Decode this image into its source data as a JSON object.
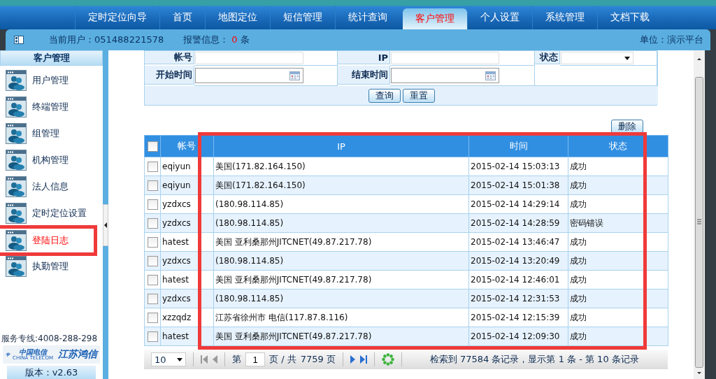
{
  "nav": {
    "tabs": [
      {
        "label": "定时定位向导",
        "selected": false
      },
      {
        "label": "首页",
        "selected": false
      },
      {
        "label": "地图定位",
        "selected": false
      },
      {
        "label": "短信管理",
        "selected": false
      },
      {
        "label": "统计查询",
        "selected": false
      },
      {
        "label": "客户管理",
        "selected": true
      },
      {
        "label": "个人设置",
        "selected": false
      },
      {
        "label": "系统管理",
        "selected": false
      },
      {
        "label": "文档下载",
        "selected": false
      }
    ]
  },
  "info_bar": {
    "user": "当前用户：051488221578",
    "alarm_label": "报警信息：",
    "alarm_count": "0",
    "alarm_unit": "条",
    "unit": "单位：演示平台"
  },
  "sidebar": {
    "title": "客户管理",
    "items": [
      {
        "label": "用户管理",
        "selected": false,
        "highlighted": false
      },
      {
        "label": "终端管理",
        "selected": false,
        "highlighted": false
      },
      {
        "label": "组管理",
        "selected": false,
        "highlighted": false
      },
      {
        "label": "机构管理",
        "selected": false,
        "highlighted": false
      },
      {
        "label": "法人信息",
        "selected": false,
        "highlighted": false
      },
      {
        "label": "定时定位设置",
        "selected": false,
        "highlighted": false
      },
      {
        "label": "登陆日志",
        "selected": true,
        "highlighted": true
      },
      {
        "label": "执勤管理",
        "selected": false,
        "highlighted": false
      }
    ],
    "hotline": "服务专线:4008-288-298",
    "logo": {
      "brand": "中国电信",
      "brand_en": "CHINA TELECOM",
      "company": "江苏鸿信"
    },
    "version": "版本：v2.63"
  },
  "filter": {
    "fields": [
      {
        "label": "帐号",
        "kind": "text"
      },
      {
        "label": "IP",
        "kind": "text"
      },
      {
        "label": "状态",
        "kind": "select"
      },
      {
        "label": "开始时间",
        "kind": "date"
      },
      {
        "label": "结束时间",
        "kind": "date"
      }
    ],
    "buttons": [
      "查询",
      "重置"
    ]
  },
  "table": {
    "delete_button": "删除",
    "highlight": true,
    "header_checked": false,
    "columns": [
      "帐号",
      "IP",
      "时间",
      "状态"
    ],
    "rows": [
      {
        "checked": false,
        "account": "eqiyun",
        "ip": "美国(171.82.164.150)",
        "time": "2015-02-14 15:03:13",
        "status": "成功"
      },
      {
        "checked": false,
        "account": "eqiyun",
        "ip": "美国(171.82.164.150)",
        "time": "2015-02-14 15:01:38",
        "status": "成功"
      },
      {
        "checked": false,
        "account": "yzdxcs",
        "ip": "(180.98.114.85)",
        "time": "2015-02-14 14:29:14",
        "status": "成功"
      },
      {
        "checked": false,
        "account": "yzdxcs",
        "ip": "(180.98.114.85)",
        "time": "2015-02-14 14:28:59",
        "status": "密码错误"
      },
      {
        "checked": false,
        "account": "hatest",
        "ip": "美国 亚利桑那州JITCNET(49.87.217.78)",
        "time": "2015-02-14 13:46:47",
        "status": "成功"
      },
      {
        "checked": false,
        "account": "yzdxcs",
        "ip": "(180.98.114.85)",
        "time": "2015-02-14 13:20:49",
        "status": "成功"
      },
      {
        "checked": false,
        "account": "hatest",
        "ip": "美国 亚利桑那州JITCNET(49.87.217.78)",
        "time": "2015-02-14 12:46:01",
        "status": "成功"
      },
      {
        "checked": false,
        "account": "yzdxcs",
        "ip": "(180.98.114.85)",
        "time": "2015-02-14 12:31:53",
        "status": "成功"
      },
      {
        "checked": false,
        "account": "xzzqdz",
        "ip": "江苏省徐州市 电信(117.87.8.116)",
        "time": "2015-02-14 12:15:39",
        "status": "成功"
      },
      {
        "checked": false,
        "account": "hatest",
        "ip": "美国 亚利桑那州JITCNET(49.87.217.78)",
        "time": "2015-02-14 12:09:30",
        "status": "成功"
      }
    ]
  },
  "pager": {
    "page_size": "10",
    "page_prefix": "第",
    "page": "1",
    "page_suffix": "页 / 共",
    "total_pages": "7759 页",
    "summary": "检索到 77584 条记录，显示第 1 条 - 第 10 条记录"
  }
}
